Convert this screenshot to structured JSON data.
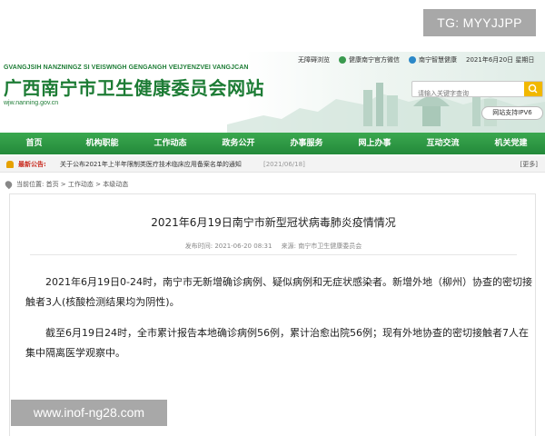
{
  "watermarks": {
    "top": "TG: MYYJJPP",
    "bottom": "www.inof-ng28.com"
  },
  "header": {
    "pinyin": "GVANGJSIH NANZNINGZ SI VEISWNGH GENGANGH VEIJYENZVEI VANGJCAN",
    "title": "广西南宁市卫生健康委员会网站",
    "url": "wjw.nanning.gov.cn",
    "toplinks": [
      "无障碍浏览",
      "健康南宁官方微信",
      "南宁智慧健康",
      "2021年6月20日 星期日"
    ],
    "search_placeholder": "请输入关键字查询",
    "ipv6": "网站支持IPV6"
  },
  "nav": [
    "首页",
    "机构职能",
    "工作动态",
    "政务公开",
    "办事服务",
    "网上办事",
    "互动交流",
    "机关党建"
  ],
  "notice": {
    "label": "最新公告:",
    "text": "关于公布2021年上半年限制类医疗技术临床应用备案名单的通知",
    "date": "[2021/06/18]",
    "more": "[更多]"
  },
  "breadcrumb": "当前位置: 首页 > 工作动态 > 本级动态",
  "article": {
    "title": "2021年6月19日南宁市新型冠状病毒肺炎疫情情况",
    "published": "发布时间: 2021-06-20 08:31",
    "source": "来源: 南宁市卫生健康委员会",
    "paragraphs": [
      "2021年6月19日0-24时，南宁市无新增确诊病例、疑似病例和无症状感染者。新增外地（柳州）协查的密切接触者3人(核酸检测结果均为阴性)。",
      "截至6月19日24时，全市累计报告本地确诊病例56例，累计治愈出院56例；现有外地协查的密切接触者7人在集中隔离医学观察中。"
    ]
  }
}
